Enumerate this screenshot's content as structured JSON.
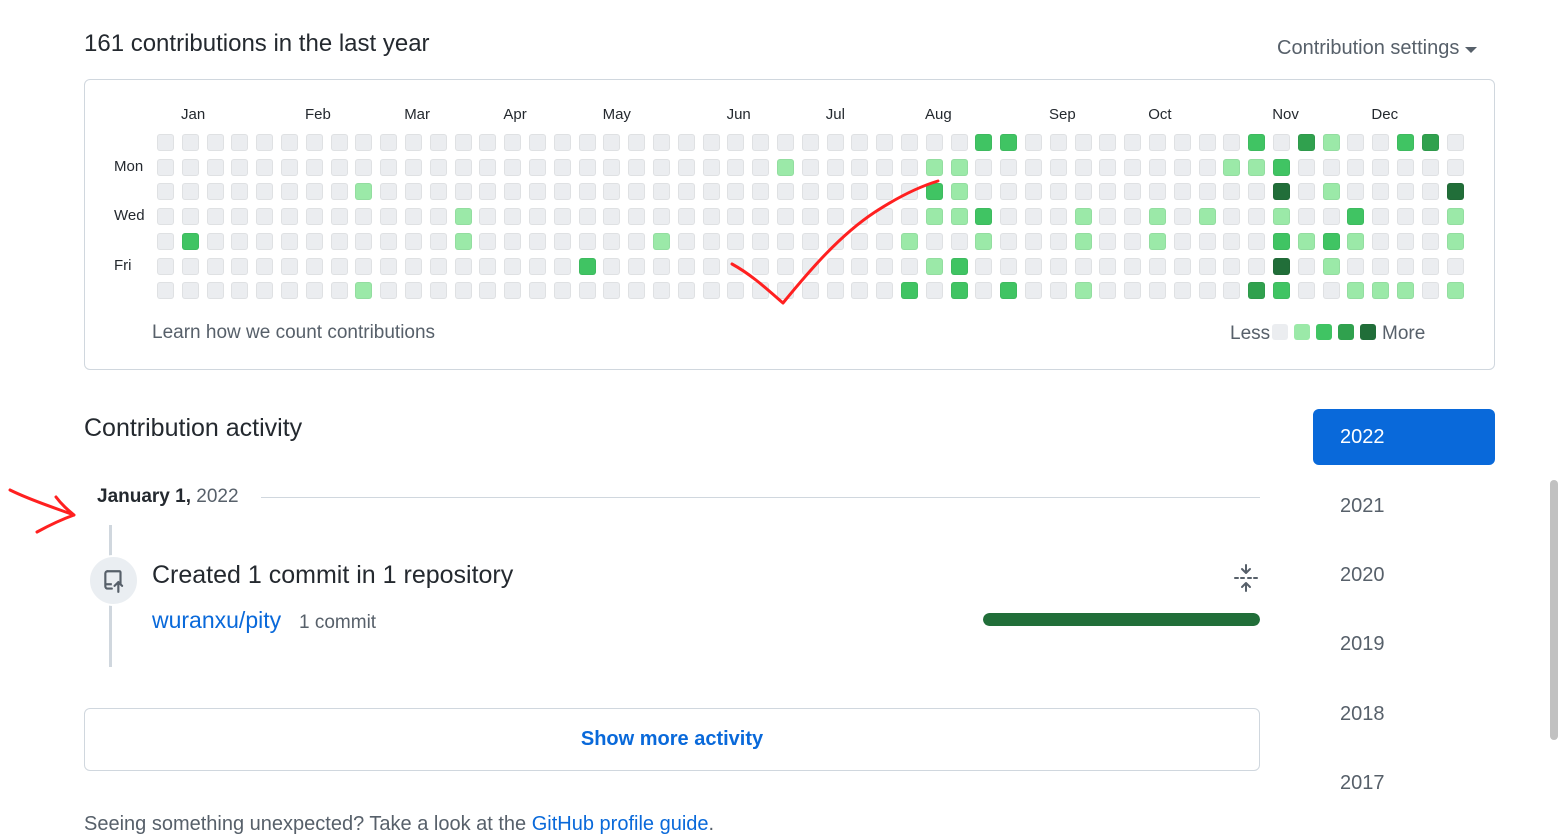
{
  "summary": {
    "title": "161 contributions in the last year",
    "settings_label": "Contribution settings"
  },
  "calendar": {
    "months": [
      {
        "label": "Jan",
        "week": 1
      },
      {
        "label": "Feb",
        "week": 6
      },
      {
        "label": "Mar",
        "week": 10
      },
      {
        "label": "Apr",
        "week": 14
      },
      {
        "label": "May",
        "week": 18
      },
      {
        "label": "Jun",
        "week": 23
      },
      {
        "label": "Jul",
        "week": 27
      },
      {
        "label": "Aug",
        "week": 31
      },
      {
        "label": "Sep",
        "week": 36
      },
      {
        "label": "Oct",
        "week": 40
      },
      {
        "label": "Nov",
        "week": 45
      },
      {
        "label": "Dec",
        "week": 49
      }
    ],
    "day_labels": [
      {
        "label": "Mon",
        "day": 1
      },
      {
        "label": "Wed",
        "day": 3
      },
      {
        "label": "Fri",
        "day": 5
      }
    ],
    "colors": [
      "#ebedf0",
      "#9be9a8",
      "#40c463",
      "#30a14e",
      "#216e39"
    ],
    "levels": [
      {
        "w": 2,
        "d": 4,
        "l": 2
      },
      {
        "w": 9,
        "d": 2,
        "l": 1
      },
      {
        "w": 9,
        "d": 6,
        "l": 1
      },
      {
        "w": 13,
        "d": 3,
        "l": 1
      },
      {
        "w": 13,
        "d": 4,
        "l": 1
      },
      {
        "w": 18,
        "d": 5,
        "l": 2
      },
      {
        "w": 21,
        "d": 4,
        "l": 1
      },
      {
        "w": 26,
        "d": 1,
        "l": 1
      },
      {
        "w": 31,
        "d": 6,
        "l": 2
      },
      {
        "w": 31,
        "d": 4,
        "l": 1
      },
      {
        "w": 32,
        "d": 1,
        "l": 1
      },
      {
        "w": 32,
        "d": 2,
        "l": 2
      },
      {
        "w": 32,
        "d": 3,
        "l": 1
      },
      {
        "w": 32,
        "d": 5,
        "l": 1
      },
      {
        "w": 33,
        "d": 1,
        "l": 1
      },
      {
        "w": 33,
        "d": 2,
        "l": 1
      },
      {
        "w": 33,
        "d": 3,
        "l": 1
      },
      {
        "w": 33,
        "d": 5,
        "l": 2
      },
      {
        "w": 33,
        "d": 6,
        "l": 2
      },
      {
        "w": 34,
        "d": 0,
        "l": 2
      },
      {
        "w": 34,
        "d": 3,
        "l": 2
      },
      {
        "w": 34,
        "d": 4,
        "l": 1
      },
      {
        "w": 35,
        "d": 0,
        "l": 2
      },
      {
        "w": 35,
        "d": 6,
        "l": 2
      },
      {
        "w": 38,
        "d": 3,
        "l": 1
      },
      {
        "w": 38,
        "d": 4,
        "l": 1
      },
      {
        "w": 38,
        "d": 6,
        "l": 1
      },
      {
        "w": 41,
        "d": 3,
        "l": 1
      },
      {
        "w": 41,
        "d": 4,
        "l": 1
      },
      {
        "w": 43,
        "d": 3,
        "l": 1
      },
      {
        "w": 44,
        "d": 1,
        "l": 1
      },
      {
        "w": 45,
        "d": 0,
        "l": 2
      },
      {
        "w": 45,
        "d": 1,
        "l": 1
      },
      {
        "w": 45,
        "d": 6,
        "l": 3
      },
      {
        "w": 46,
        "d": 1,
        "l": 2
      },
      {
        "w": 46,
        "d": 2,
        "l": 4
      },
      {
        "w": 46,
        "d": 3,
        "l": 1
      },
      {
        "w": 46,
        "d": 4,
        "l": 2
      },
      {
        "w": 46,
        "d": 5,
        "l": 4
      },
      {
        "w": 46,
        "d": 6,
        "l": 2
      },
      {
        "w": 47,
        "d": 0,
        "l": 3
      },
      {
        "w": 47,
        "d": 4,
        "l": 1
      },
      {
        "w": 48,
        "d": 0,
        "l": 1
      },
      {
        "w": 48,
        "d": 2,
        "l": 1
      },
      {
        "w": 48,
        "d": 4,
        "l": 2
      },
      {
        "w": 48,
        "d": 5,
        "l": 1
      },
      {
        "w": 49,
        "d": 3,
        "l": 2
      },
      {
        "w": 49,
        "d": 4,
        "l": 1
      },
      {
        "w": 49,
        "d": 6,
        "l": 1
      },
      {
        "w": 50,
        "d": 6,
        "l": 1
      },
      {
        "w": 51,
        "d": 0,
        "l": 2
      },
      {
        "w": 51,
        "d": 6,
        "l": 1
      },
      {
        "w": 52,
        "d": 0,
        "l": 3
      },
      {
        "w": 53,
        "d": 2,
        "l": 4
      },
      {
        "w": 53,
        "d": 3,
        "l": 1
      },
      {
        "w": 53,
        "d": 4,
        "l": 1
      },
      {
        "w": 53,
        "d": 6,
        "l": 1
      }
    ],
    "learn_label": "Learn how we count contributions",
    "legend_less": "Less",
    "legend_more": "More"
  },
  "activity": {
    "title": "Contribution activity",
    "date_bold": "January 1,",
    "date_year": "2022",
    "commit_title": "Created 1 commit in 1 repository",
    "repo": "wuranxu/pity",
    "commit_count": "1 commit",
    "progress": 1.0,
    "show_more": "Show more activity"
  },
  "years": [
    "2022",
    "2021",
    "2020",
    "2019",
    "2018",
    "2017"
  ],
  "selected_year": "2022",
  "footer": {
    "prefix": "Seeing something unexpected? Take a look at the ",
    "link": "GitHub profile guide",
    "suffix": "."
  }
}
